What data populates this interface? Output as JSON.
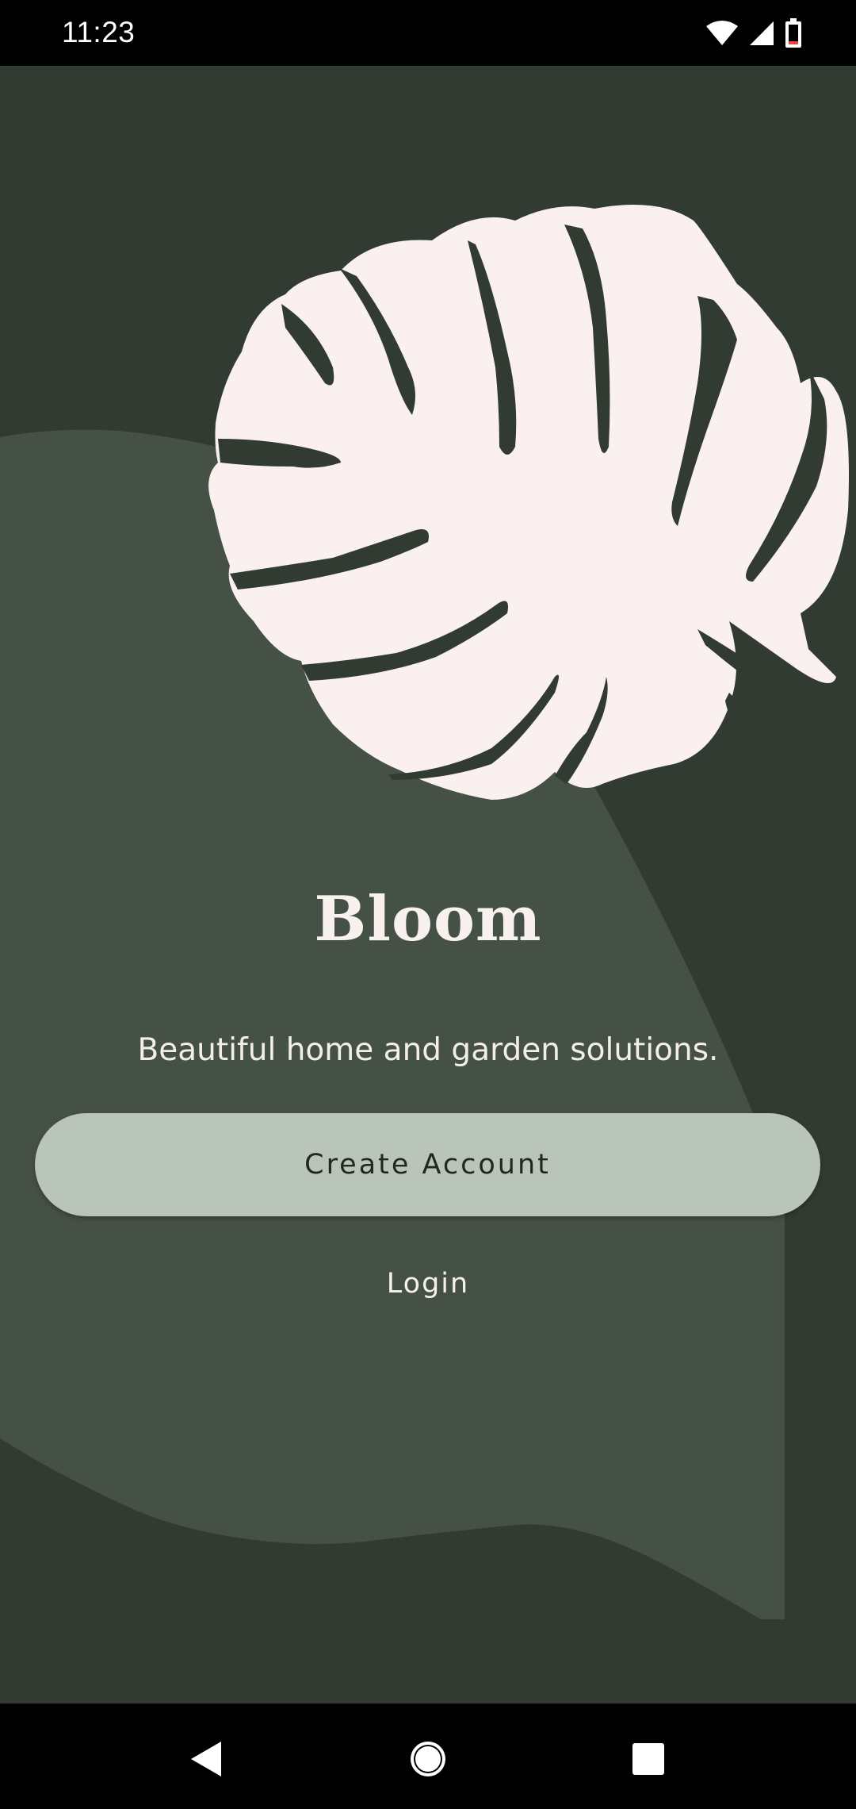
{
  "status_bar": {
    "time": "11:23",
    "icons": [
      "wifi-icon",
      "cell-signal-icon",
      "battery-icon"
    ]
  },
  "app": {
    "title": "Bloom",
    "tagline": "Beautiful home and garden solutions.",
    "logo_icon": "monstera-leaf-icon",
    "colors": {
      "background": "#323b31",
      "shape": "#465145",
      "leaf": "#f9f0ef",
      "button_fill": "#bac5ba",
      "button_text": "#222821"
    }
  },
  "actions": {
    "create_account_label": "Create Account",
    "login_label": "Login"
  },
  "nav_bar": {
    "buttons": [
      "back-icon",
      "home-icon",
      "recents-icon"
    ]
  }
}
